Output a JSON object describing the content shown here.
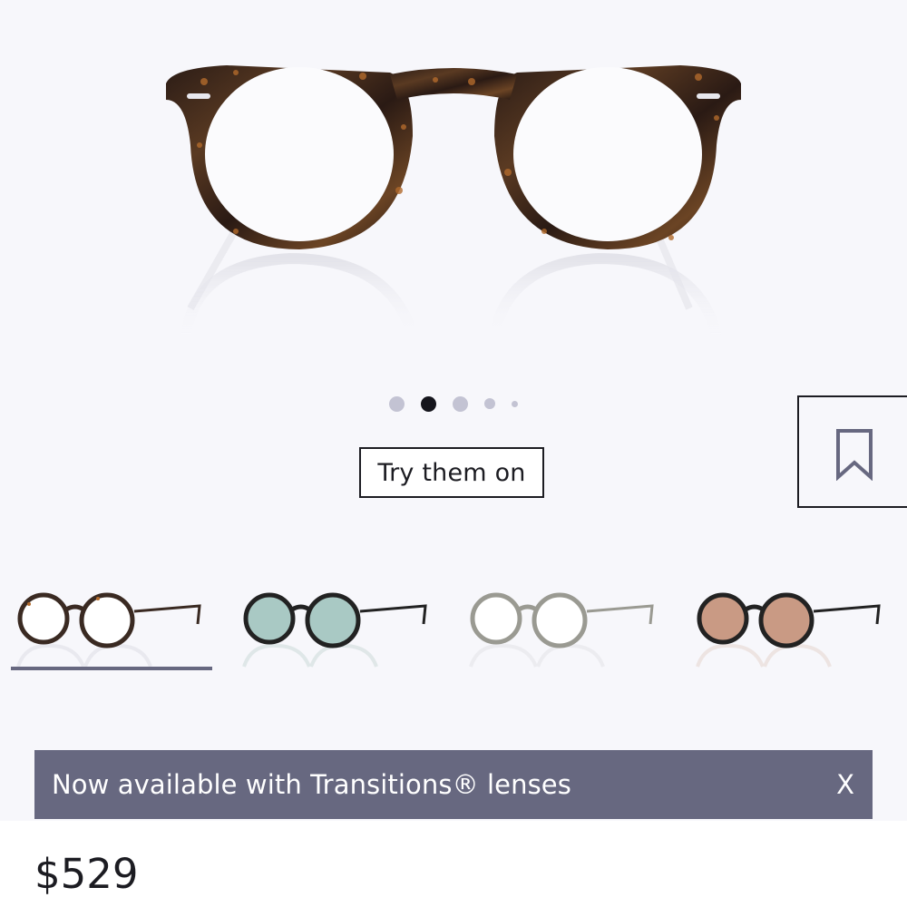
{
  "product": {
    "image_dots": {
      "count": 5,
      "active_index": 1
    },
    "try_on_label": "Try them on",
    "save_icon": "bookmark-icon",
    "variants": [
      {
        "name": "tortoise",
        "frame_color": "#3a2a22",
        "lens_color": "#ffffff",
        "selected": true
      },
      {
        "name": "black-green-lens",
        "frame_color": "#222222",
        "lens_color": "#a9c9c4",
        "selected": false
      },
      {
        "name": "grey-clear",
        "frame_color": "#9a9a92",
        "lens_color": "#ffffff",
        "selected": false
      },
      {
        "name": "black-brown-lens",
        "frame_color": "#222222",
        "lens_color": "#c99a84",
        "selected": false
      }
    ],
    "banner": {
      "message": "Now available with Transitions® lenses",
      "close_label": "X"
    },
    "price": "$529"
  },
  "colors": {
    "background": "#f7f7fb",
    "banner_bg": "#676880",
    "text": "#1c1c22",
    "dot_inactive": "#c3c3d3",
    "dot_active": "#15151c"
  }
}
